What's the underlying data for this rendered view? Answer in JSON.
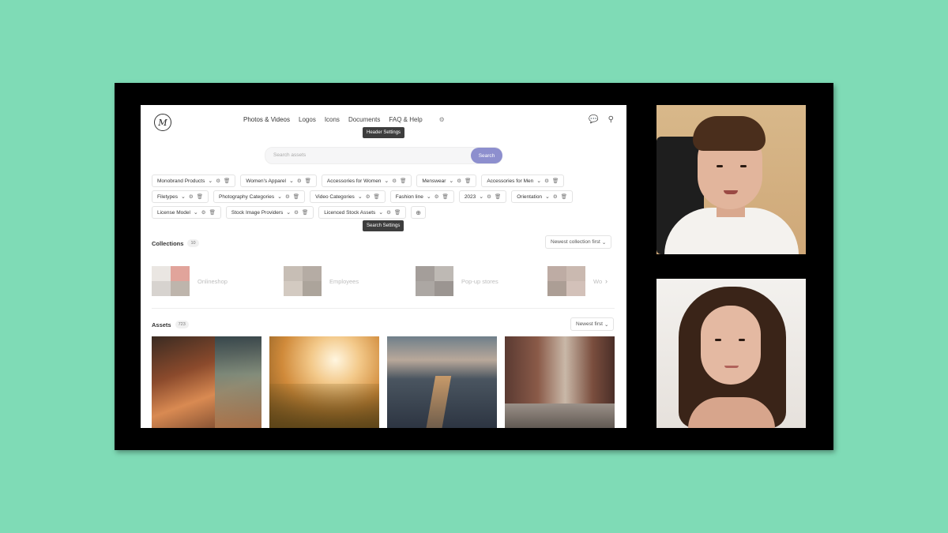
{
  "header": {
    "nav": [
      "Photos & Videos",
      "Logos",
      "Icons",
      "Documents",
      "FAQ & Help"
    ],
    "header_tooltip": "Header Settings"
  },
  "search": {
    "placeholder": "Search assets",
    "button": "Search",
    "tooltip": "Search Settings"
  },
  "filters": {
    "row1": [
      "Monobrand Products",
      "Women's Apparel",
      "Accessories for Women",
      "Menswear",
      "Accessories for Men"
    ],
    "row2": [
      "Filetypes",
      "Photography Categories",
      "Video Categories",
      "Fashion line",
      "2023",
      "Orientation"
    ],
    "row3": [
      "License Model",
      "Stock Image Providers",
      "Licenced Stock Assets"
    ]
  },
  "collections": {
    "title": "Collections",
    "count": "10",
    "sort": "Newest collection first",
    "items": [
      "Onlineshop",
      "Employees",
      "Pop-up stores",
      "Wo"
    ]
  },
  "assets": {
    "title": "Assets",
    "count": "723",
    "sort": "Newest first"
  },
  "colors": {
    "background": "#7fdbb6",
    "search_button": "#8d8fce"
  }
}
